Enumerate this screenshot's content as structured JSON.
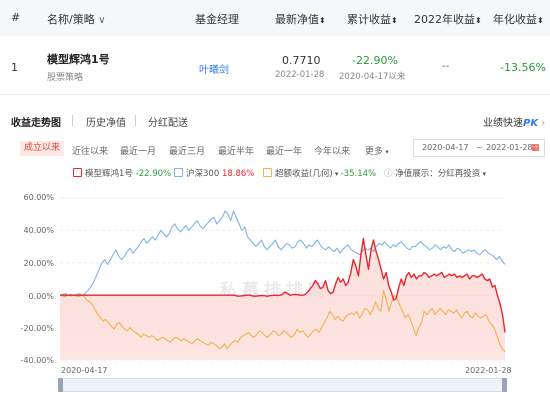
{
  "table": {
    "headers": {
      "index": "#",
      "name": "名称/策略",
      "manager": "基金经理",
      "nav": "最新净值",
      "cumulative": "累计收益",
      "ytd": "2022年收益",
      "annual": "年化收益"
    },
    "row": {
      "index": "1",
      "name": "模型辉鸿1号",
      "strategy": "股票策略",
      "manager": "叶曦剑",
      "nav": "0.7710",
      "nav_date": "2022-01-28",
      "cumulative": "-22.90%",
      "cumulative_since": "2020-04-17以来",
      "ytd": "--",
      "annual": "-13.56%"
    }
  },
  "tabs": {
    "items": [
      "收益走势图",
      "历史净值",
      "分红配送"
    ],
    "active": "收益走势图",
    "pk_prefix": "业绩快速",
    "pk_label": "PK"
  },
  "ranges": {
    "items": [
      "成立以来",
      "近往以来",
      "最近一月",
      "最近三月",
      "最近半年",
      "最近一年",
      "今年以来",
      "更多"
    ],
    "active": "成立以来"
  },
  "date_range": {
    "start": "2020-04-17",
    "sep": "~",
    "end": "2022-01-28"
  },
  "legend": {
    "fund": {
      "label": "模型辉鸿1号",
      "value": "-22.90%"
    },
    "index": {
      "label": "沪深300",
      "value": "18.86%"
    },
    "excess": {
      "label": "超额收益(几何)",
      "value": "-35.14%"
    },
    "nav_display": "净值展示：分红再投资"
  },
  "watermark": "私募排排网",
  "colors": {
    "fund": "#e8262f",
    "index": "#7fb3e8",
    "excess": "#f5b14c",
    "positive": "#2a9c3a",
    "negative": "#e8262f",
    "accent": "#2e7be6"
  },
  "chart_data": {
    "type": "line",
    "x_start": "2020-04-17",
    "x_end": "2022-01-28",
    "x_tick_labels": [
      "2020-04-17",
      "2022-01-28"
    ],
    "y_tick_labels": [
      "60.00%",
      "40.00%",
      "20.00%",
      "0.00%",
      "-20.00%",
      "-40.00%"
    ],
    "ylim": [
      -40,
      60
    ],
    "grid": true,
    "series": [
      {
        "name": "模型辉鸿1号",
        "color": "#e8262f",
        "area": true,
        "values": [
          0,
          0,
          0,
          0,
          0,
          0,
          0,
          0,
          0,
          0,
          0,
          0,
          0,
          0,
          0,
          0,
          0,
          0,
          0,
          0,
          0,
          0,
          0,
          0,
          0,
          0,
          0,
          0,
          0,
          0,
          0,
          0,
          0,
          0,
          0,
          0,
          0,
          0,
          0,
          0,
          0,
          0,
          0,
          0,
          0,
          0,
          0,
          0,
          0,
          0,
          0,
          0,
          0,
          0,
          0,
          0,
          0,
          0,
          0,
          0,
          0,
          0,
          0,
          0,
          0,
          0,
          0,
          0,
          0,
          0,
          -0.5,
          -0.6,
          -0.4,
          -0.2,
          0,
          0,
          -0.4,
          -0.6,
          -0.5,
          -0.3,
          -0.2,
          -0.4,
          -0.6,
          -0.3,
          -0.1,
          0,
          -0.1,
          0,
          0.5,
          2,
          1,
          0,
          0.3,
          0.5,
          0.3,
          0,
          0,
          0.5,
          2,
          4,
          6,
          9,
          7,
          4,
          5,
          9,
          3,
          1,
          2,
          7,
          11,
          8,
          10,
          6,
          8,
          14,
          22,
          18,
          12,
          25,
          35,
          25,
          16,
          28,
          34,
          27,
          22,
          16,
          10,
          14,
          6,
          2,
          -3,
          -2,
          5,
          10,
          6,
          12,
          14,
          11,
          13,
          10,
          12,
          12,
          14,
          13,
          11,
          12,
          13,
          12,
          13,
          14,
          11,
          12,
          13,
          12,
          13,
          11,
          12,
          11,
          12,
          13,
          10,
          12,
          12,
          11,
          12,
          13,
          10,
          9,
          10,
          5,
          6,
          0,
          -5,
          -12,
          -23
        ]
      },
      {
        "name": "沪深300",
        "color": "#7fb3e8",
        "values": [
          0,
          0.5,
          1,
          0,
          -0.5,
          0,
          0.5,
          1,
          0,
          1,
          3,
          5,
          8,
          12,
          16,
          20,
          22,
          19,
          22,
          25,
          28,
          24,
          22,
          24,
          27,
          29,
          26,
          28,
          30,
          33,
          35,
          32,
          34,
          36,
          34,
          37,
          40,
          38,
          36,
          38,
          42,
          44,
          41,
          39,
          41,
          43,
          40,
          42,
          44,
          46,
          43,
          41,
          43,
          45,
          47,
          48,
          44,
          46,
          48,
          52,
          50,
          46,
          52,
          48,
          44,
          40,
          42,
          36,
          34,
          32,
          30,
          32,
          34,
          30,
          28,
          30,
          32,
          34,
          30,
          28,
          30,
          32,
          31,
          29,
          30,
          33,
          34,
          32,
          29,
          31,
          30,
          32,
          34,
          31,
          29,
          28,
          30,
          28,
          27,
          29,
          26,
          28,
          30,
          31,
          28,
          27,
          26,
          25,
          27,
          29,
          28,
          29,
          27,
          30,
          32,
          31,
          33,
          31,
          29,
          31,
          30,
          32,
          33,
          31,
          29,
          28,
          30,
          30,
          32,
          33,
          31,
          30,
          28,
          29,
          31,
          30,
          28,
          30,
          29,
          31,
          28,
          27,
          29,
          28,
          26,
          27,
          28,
          27,
          28,
          26,
          25,
          27,
          28,
          26,
          25,
          24,
          22,
          24,
          21,
          19
        ]
      },
      {
        "name": "超额收益(几何)",
        "color": "#f5b14c",
        "values": [
          0,
          -0.5,
          -1,
          0,
          0.5,
          0,
          -0.5,
          -1,
          0,
          -1,
          -3,
          -4,
          -6,
          -9,
          -12,
          -14,
          -16,
          -15,
          -17,
          -19,
          -21,
          -18,
          -17,
          -19,
          -21,
          -22,
          -20,
          -22,
          -23,
          -24,
          -26,
          -24,
          -25,
          -26,
          -25,
          -26,
          -28,
          -27,
          -26,
          -27,
          -28,
          -29,
          -27,
          -26,
          -27,
          -28,
          -27,
          -28,
          -29,
          -30,
          -28,
          -27,
          -28,
          -29,
          -30,
          -31,
          -29,
          -30,
          -31,
          -33,
          -32,
          -30,
          -33,
          -31,
          -29,
          -28,
          -29,
          -26,
          -25,
          -24,
          -23,
          -25,
          -26,
          -24,
          -22,
          -23,
          -25,
          -26,
          -24,
          -22,
          -23,
          -25,
          -24,
          -22,
          -23,
          -25,
          -26,
          -24,
          -21,
          -23,
          -22,
          -24,
          -26,
          -24,
          -22,
          -21,
          -23,
          -20,
          -17,
          -14,
          -10,
          -12,
          -15,
          -13,
          -15,
          -16,
          -13,
          -12,
          -11,
          -12,
          -10,
          -14,
          -12,
          -8,
          -9,
          -12,
          -9,
          -4,
          -8,
          -10,
          3,
          -3,
          -10,
          -4,
          0,
          -2,
          -6,
          -10,
          -14,
          -12,
          -15,
          -20,
          -25,
          -20,
          -17,
          -10,
          -12,
          -10,
          -8,
          -12,
          -10,
          -8,
          -10,
          -12,
          -9,
          -10,
          -11,
          -9,
          -12,
          -14,
          -11,
          -10,
          -13,
          -14,
          -11,
          -13,
          -14,
          -13,
          -12,
          -16,
          -18,
          -20,
          -25,
          -30,
          -33,
          -35
        ]
      }
    ]
  }
}
